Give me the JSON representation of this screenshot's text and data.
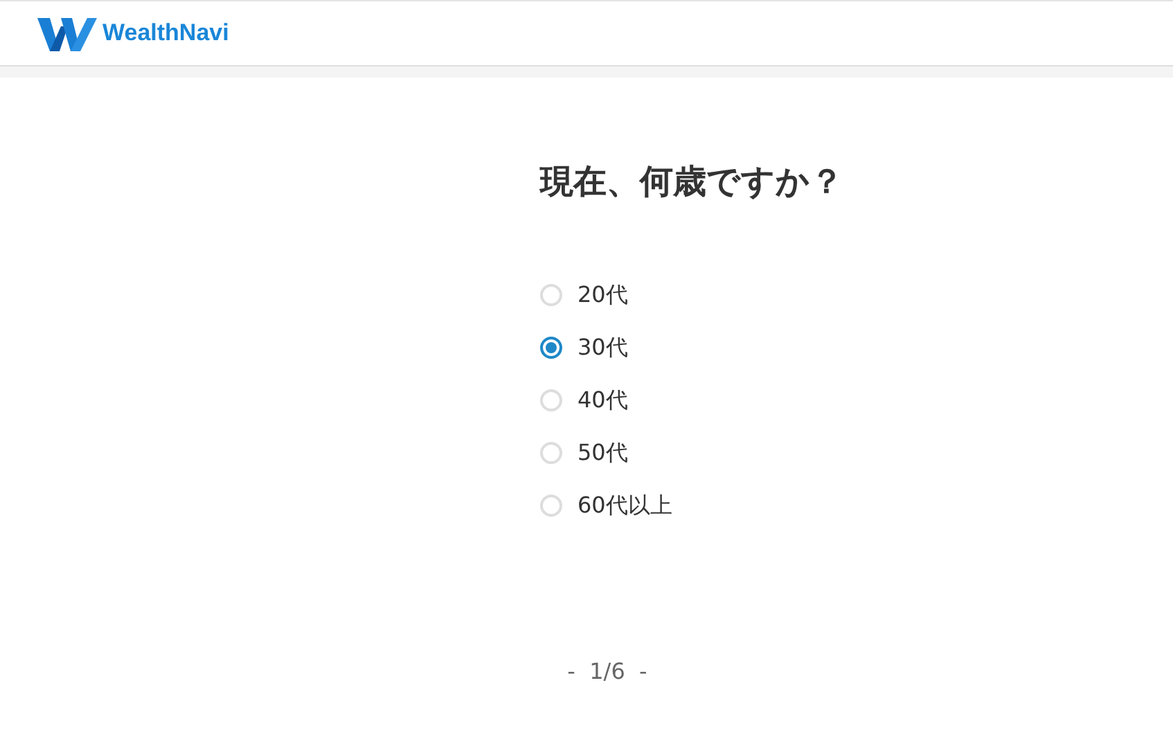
{
  "header": {
    "logo_text": "WealthNavi"
  },
  "question": {
    "title": "現在、何歳ですか？",
    "options": [
      {
        "label": "20代",
        "selected": false
      },
      {
        "label": "30代",
        "selected": true
      },
      {
        "label": "40代",
        "selected": false
      },
      {
        "label": "50代",
        "selected": false
      },
      {
        "label": "60代以上",
        "selected": false
      }
    ]
  },
  "pagination": "-  1/6  -"
}
